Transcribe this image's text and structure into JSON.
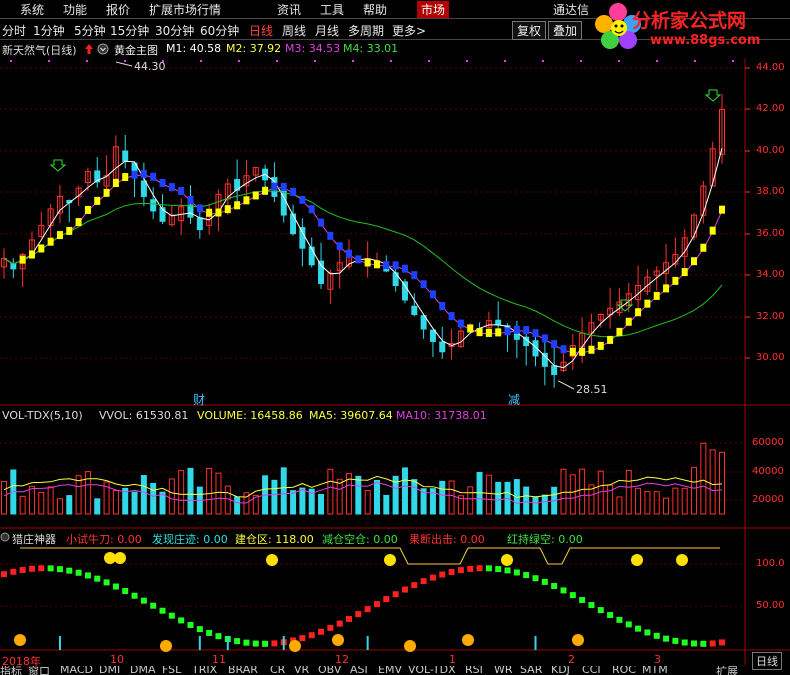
{
  "menu": {
    "items": [
      "系统",
      "功能",
      "报价",
      "扩展市场行情",
      "资讯",
      "工具",
      "帮助"
    ],
    "market": "市场",
    "right": "通达信"
  },
  "periods": {
    "items": [
      "分时",
      "1分钟",
      "5分钟",
      "15分钟",
      "30分钟",
      "60分钟",
      "日线",
      "周线",
      "月线",
      "多周期",
      "更多>"
    ],
    "active": "日线",
    "buttons": [
      "复权",
      "叠加"
    ]
  },
  "logo": {
    "title": "分析家公式网",
    "url": "www.88gs.com"
  },
  "main_header": {
    "stock": "新天然气(日线)",
    "indicator": "黄金主图",
    "m1": "M1: 40.58",
    "m2": "M2: 37.92",
    "m3": "M3: 34.53",
    "m4": "M4: 33.01"
  },
  "vol_header": {
    "name": "VOL-TDX(5,10)",
    "vvol": "VVOL: 61530.81",
    "volume": "VOLUME: 16458.86",
    "ma5": "MA5: 39607.64",
    "ma10": "MA10: 31738.01"
  },
  "ind_header": {
    "name": "猎庄神器",
    "f1": "小试牛刀: 0.00",
    "f2": "发现庄迹: 0.00",
    "f3": "建仓区: 118.00",
    "f4": "减仓空仓: 0.00",
    "f5": "果断出击: 0.00",
    "f6": "红持绿空: 0.00"
  },
  "price_axis": [
    "44.00",
    "42.00",
    "40.00",
    "38.00",
    "36.00",
    "34.00",
    "32.00",
    "30.00"
  ],
  "vol_axis": [
    "60000",
    "40000",
    "20000"
  ],
  "ind_axis": [
    "100.0",
    "50.00"
  ],
  "annotations": {
    "high": "44.30",
    "low": "28.51",
    "marker_cai": "财",
    "marker_jian": "减"
  },
  "date_labels": [
    "2018年",
    "10",
    "11",
    "12",
    "1",
    "2",
    "3"
  ],
  "period_label": "日线",
  "bottom_tabs": [
    "指标",
    "窗口",
    "MACD",
    "DMI",
    "DMA",
    "FSL",
    "TRIX",
    "BRAR",
    "CR",
    "VR",
    "OBV",
    "ASI",
    "EMV",
    "VOL-TDX",
    "RSI",
    "WR",
    "SAR",
    "KDJ",
    "CCI",
    "ROC",
    "MTM",
    "扩展"
  ],
  "colors": {
    "up": "#ff3030",
    "down": "#30d8e8",
    "yellow": "#ffff00",
    "ma_white": "#ffffff",
    "ma_magenta": "#e040e0",
    "ma_green": "#20c020",
    "grid": "#5a0000"
  },
  "chart_data": {
    "type": "candlestick",
    "y_range": [
      28.0,
      44.5
    ],
    "high": 44.3,
    "low": 28.51,
    "close": [
      34.8,
      34.3,
      35.0,
      35.7,
      36.4,
      37.2,
      37.8,
      37.5,
      38.2,
      39.0,
      38.5,
      38.8,
      40.2,
      39.5,
      38.7,
      37.8,
      37.1,
      36.6,
      36.9,
      37.3,
      36.8,
      36.2,
      37.0,
      37.9,
      38.4,
      38.1,
      38.8,
      39.2,
      38.6,
      37.8,
      36.9,
      36.0,
      35.3,
      34.5,
      33.6,
      34.1,
      34.6,
      34.9,
      34.7,
      34.8,
      34.6,
      34.2,
      33.5,
      32.8,
      32.1,
      31.4,
      30.8,
      30.3,
      30.7,
      31.3,
      31.6,
      31.4,
      31.8,
      31.6,
      31.2,
      30.9,
      30.6,
      30.1,
      29.6,
      29.2,
      29.8,
      30.6,
      31.2,
      31.7,
      32.1,
      32.4,
      32.7,
      33.1,
      33.5,
      33.9,
      34.2,
      34.6,
      35.0,
      35.8,
      36.9,
      38.3,
      40.1,
      42.0
    ]
  }
}
